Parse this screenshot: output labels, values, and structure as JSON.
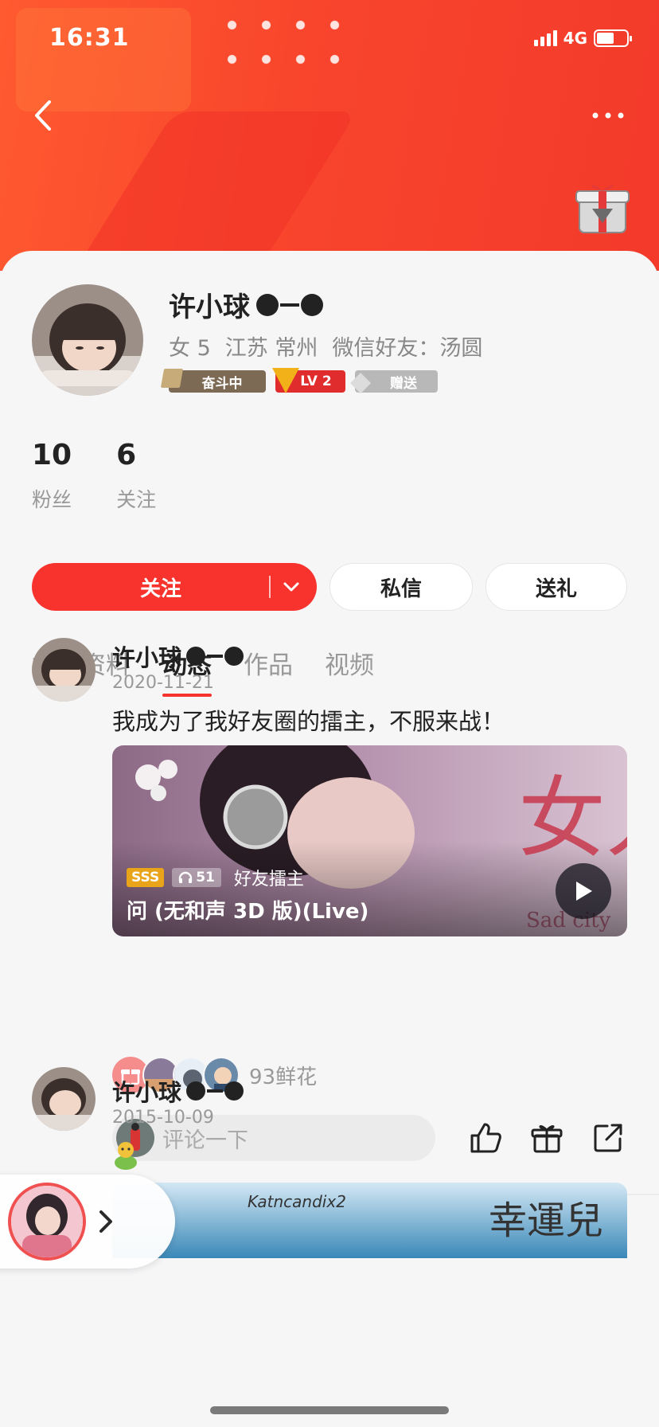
{
  "status_bar": {
    "time": "16:31",
    "network": "4G",
    "battery_level": 0.58
  },
  "profile": {
    "name": "许小球",
    "gender": "女",
    "age": "5",
    "location": "江苏 常州",
    "friend_relation": "微信好友：汤圆",
    "badges": {
      "struggle": "奋斗中",
      "level": "LV 2",
      "gift": "赠送"
    },
    "stats": [
      {
        "count": "10",
        "label": "粉丝"
      },
      {
        "count": "6",
        "label": "关注"
      }
    ]
  },
  "actions": {
    "follow": "关注",
    "message": "私信",
    "gift": "送礼"
  },
  "tabs": [
    {
      "label": "相册资料",
      "active": false
    },
    {
      "label": "动态",
      "active": true
    },
    {
      "label": "作品",
      "active": false
    },
    {
      "label": "视频",
      "active": false
    }
  ],
  "posts": [
    {
      "author": "许小球",
      "date": "2020-11-21",
      "text": "我成为了我好友圈的擂主，不服来战！",
      "media": {
        "rating": "SSS",
        "plays": "51",
        "kind": "好友擂主",
        "title": "问 (无和声 3D 版)(Live)",
        "cover_big_text": "女人",
        "cover_small_text": "Sad city"
      },
      "flowers": "93鲜花",
      "comment_placeholder": "评论一下"
    },
    {
      "author": "许小球",
      "date": "2015-10-09",
      "cover_text_small": "Katncandix2",
      "cover_text_big": "幸運兒"
    }
  ],
  "colors": {
    "accent": "#f8332e",
    "header": "#f5452d",
    "badge_gold": "#e9a41a"
  },
  "icons": [
    "back-icon",
    "more-icon",
    "gift-box-icon",
    "chevron-down-icon",
    "headphones-icon",
    "play-icon",
    "gift-icon",
    "like-icon",
    "share-icon",
    "chevron-right-icon"
  ]
}
